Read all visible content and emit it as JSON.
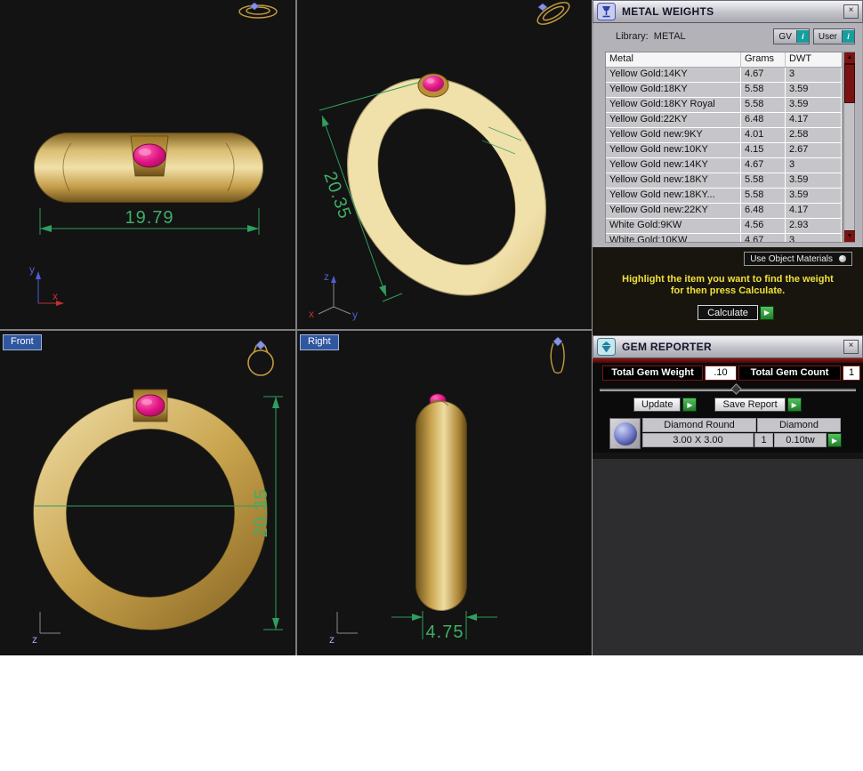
{
  "viewports": {
    "top_left": {
      "dimension": "19.79",
      "axis_y": "y",
      "axis_x": "x"
    },
    "top_right": {
      "dimension": "20.35",
      "axis_z": "z",
      "axis_x": "x",
      "axis_y": "y"
    },
    "bottom_left": {
      "label": "Front",
      "dimension": "20.35",
      "axis_z": "z"
    },
    "bottom_right": {
      "label": "Right",
      "dimension": "4.75",
      "axis_z": "z"
    }
  },
  "metal_weights": {
    "title": "METAL WEIGHTS",
    "close_label": "×",
    "library_label": "Library:  METAL",
    "gv_label": "GV",
    "user_label": "User",
    "info_label": "i",
    "table": {
      "headers": [
        "Metal",
        "Grams",
        "DWT"
      ],
      "rows": [
        [
          "Yellow Gold:14KY",
          "4.67",
          "3"
        ],
        [
          "Yellow Gold:18KY",
          "5.58",
          "3.59"
        ],
        [
          "Yellow Gold:18KY Royal",
          "5.58",
          "3.59"
        ],
        [
          "Yellow Gold:22KY",
          "6.48",
          "4.17"
        ],
        [
          "Yellow Gold new:9KY",
          "4.01",
          "2.58"
        ],
        [
          "Yellow Gold new:10KY",
          "4.15",
          "2.67"
        ],
        [
          "Yellow Gold new:14KY",
          "4.67",
          "3"
        ],
        [
          "Yellow Gold new:18KY",
          "5.58",
          "3.59"
        ],
        [
          "Yellow Gold new:18KY...",
          "5.58",
          "3.59"
        ],
        [
          "Yellow Gold new:22KY",
          "6.48",
          "4.17"
        ],
        [
          "White Gold:9KW",
          "4.56",
          "2.93"
        ],
        [
          "White Gold:10KW",
          "4.67",
          "3"
        ]
      ]
    },
    "use_object_materials_label": "Use Object Materials",
    "hint_line1": "Highlight the item you want to find the weight",
    "hint_line2": "for then press Calculate.",
    "calculate_label": "Calculate",
    "go_arrow": "▶"
  },
  "gem_reporter": {
    "title": "GEM REPORTER",
    "close_label": "×",
    "total_gem_weight_label": "Total Gem Weight",
    "total_gem_weight_value": ".10",
    "total_gem_count_label": "Total Gem Count",
    "total_gem_count_value": "1",
    "update_label": "Update",
    "save_report_label": "Save Report",
    "gem": {
      "name": "Diamond Round",
      "type": "Diamond",
      "size": "3.00 X 3.00",
      "count": "1",
      "weight": "0.10tw"
    },
    "go_arrow": "▶"
  },
  "scrollbar": {
    "up": "▲",
    "down": "▼"
  },
  "colors": {
    "dimension_green": "#3fae67",
    "gold": "#c9a44e",
    "gem_pink": "#e01583",
    "maroon": "#7a1414",
    "hint_yellow": "#f0e03a",
    "go_green": "#2f9e3f",
    "viewport_label_blue": "#3056a0"
  }
}
